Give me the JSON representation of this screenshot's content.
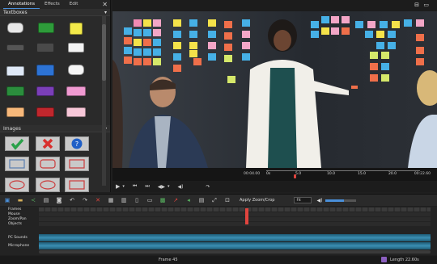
{
  "panel": {
    "tabs": [
      "Annotations",
      "Effects",
      "Edit"
    ],
    "close_label": "✕",
    "section_textboxes": "Textboxes",
    "section_images": "Images"
  },
  "player": {
    "time_current": "00:04.00",
    "time_total": "00:22.60",
    "ruler": [
      "0s",
      "5.0",
      "10.0",
      "15.0",
      "20.0"
    ]
  },
  "toolbar": {
    "apply_zoom_label": "Apply Zoom/Crop",
    "zoom_mode": "Fit"
  },
  "tracks": {
    "labels": [
      "Frames",
      "Mouse",
      "Zoom/Pan",
      "Objects"
    ],
    "audio": [
      "PC Sounds",
      "Microphone"
    ]
  },
  "status": {
    "frame": "Frame 45",
    "length": "Length 22.60s"
  }
}
